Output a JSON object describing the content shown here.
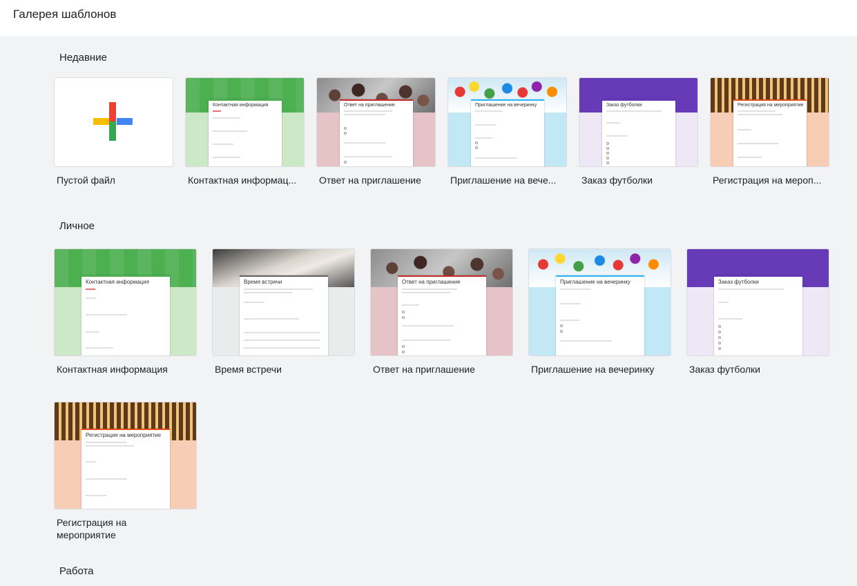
{
  "header": {
    "title": "Галерея шаблонов"
  },
  "sections": {
    "recent": {
      "title": "Недавние",
      "items": [
        {
          "label": "Пустой файл"
        },
        {
          "label": "Контактная информац...",
          "form_title": "Контактная информация"
        },
        {
          "label": "Ответ на приглашение",
          "form_title": "Ответ на приглашение"
        },
        {
          "label": "Приглашение на вече...",
          "form_title": "Приглашение на вечеринку"
        },
        {
          "label": "Заказ футболки",
          "form_title": "Заказ футболки"
        },
        {
          "label": "Регистрация на мероп...",
          "form_title": "Регистрация на мероприятие"
        }
      ]
    },
    "personal": {
      "title": "Личное",
      "items": [
        {
          "label": "Контактная информация",
          "form_title": "Контактная информация"
        },
        {
          "label": "Время встречи",
          "form_title": "Время встречи"
        },
        {
          "label": "Ответ на приглашение",
          "form_title": "Ответ на приглашение"
        },
        {
          "label": "Приглашение на вечеринку",
          "form_title": "Приглашение на вечеринку"
        },
        {
          "label": "Заказ футболки",
          "form_title": "Заказ футболки"
        },
        {
          "label": "Регистрация на мероприятие",
          "form_title": "Регистрация на мероприятие"
        }
      ]
    },
    "work": {
      "title": "Работа"
    }
  },
  "colors": {
    "accent_green": "#4caf50",
    "accent_purple": "#673ab7",
    "pink": "#e6c3c6",
    "light_blue": "#c2e8f5",
    "peach": "#f7cdb6",
    "lavender": "#ede7f6",
    "light_green": "#cde8c7"
  }
}
